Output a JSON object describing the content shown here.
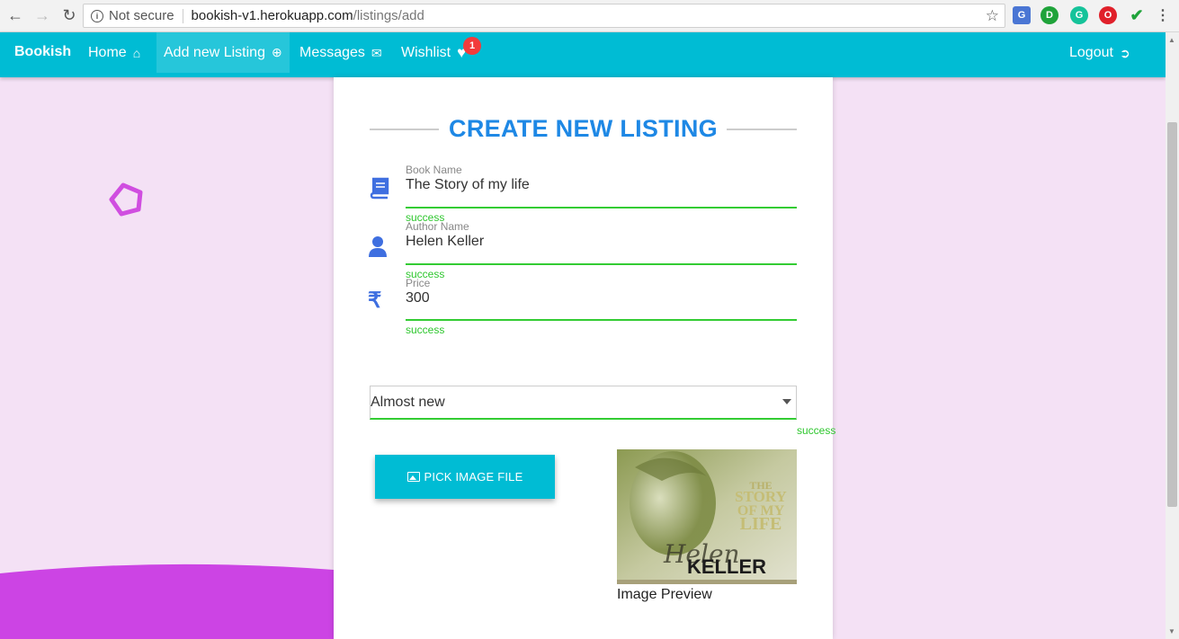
{
  "browser": {
    "not_secure": "Not secure",
    "url_host": "bookish-v1.herokuapp.com",
    "url_path": "/listings/add"
  },
  "navbar": {
    "brand": "Bookish",
    "items": [
      {
        "label": "Home"
      },
      {
        "label": "Add new Listing"
      },
      {
        "label": "Messages"
      },
      {
        "label": "Wishlist"
      }
    ],
    "wishlist_count": "1",
    "logout": "Logout"
  },
  "form": {
    "title": "CREATE NEW LISTING",
    "fields": [
      {
        "label": "Book Name",
        "value": "The Story of my life",
        "status": "success"
      },
      {
        "label": "Author Name",
        "value": "Helen Keller",
        "status": "success"
      },
      {
        "label": "Price",
        "value": "300",
        "status": "success"
      }
    ],
    "condition": {
      "value": "Almost new",
      "status": "success"
    },
    "pick_button": "PICK IMAGE FILE",
    "preview_label": "Image Preview",
    "cover": {
      "line1": "THE",
      "line2": "STORY",
      "line3": "OF MY",
      "line4": "LIFE",
      "signature": "Helen",
      "author": "KELLER"
    }
  },
  "colors": {
    "primary": "#00bcd4",
    "heading": "#1e88e5",
    "success": "#33cc33",
    "background": "#f4e1f5",
    "badge": "#f23b3b"
  }
}
